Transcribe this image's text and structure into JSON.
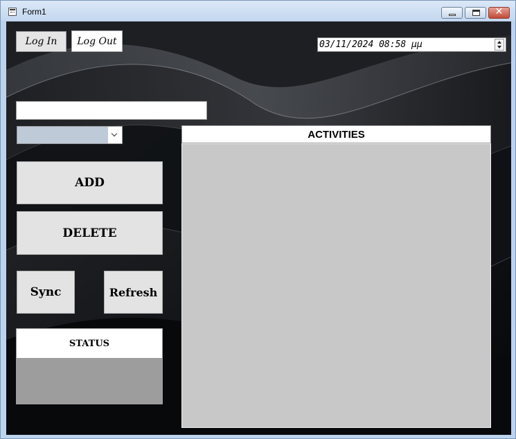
{
  "window": {
    "title": "Form1"
  },
  "auth": {
    "login_label": "Log In",
    "logout_label": "Log Out"
  },
  "datetime_picker": {
    "value": "03/11/2024 08:58 μμ"
  },
  "inputs": {
    "text_value": "",
    "combo_value": ""
  },
  "actions": {
    "add_label": "ADD",
    "delete_label": "DELETE",
    "sync_label": "Sync",
    "refresh_label": "Refresh"
  },
  "status": {
    "header": "STATUS",
    "text": ""
  },
  "activities": {
    "header": "ACTIVITIES",
    "items": []
  },
  "colors": {
    "client_background": "#0d0f12",
    "activities_list": "#c8c8c8",
    "status_body": "#9d9d9d",
    "combo_fill": "#bfcad8",
    "button_fill": "#e3e3e3"
  }
}
